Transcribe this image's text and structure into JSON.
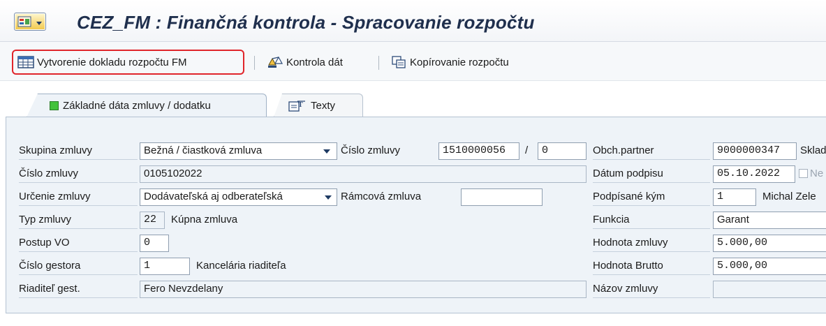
{
  "window": {
    "title": "CEZ_FM : Finančná kontrola - Spracovanie rozpočtu"
  },
  "toolbar": {
    "create_budget_doc": "Vytvorenie dokladu rozpočtu FM",
    "check_data": "Kontrola dát",
    "copy_budget": "Kopírovanie rozpočtu"
  },
  "tabs": [
    {
      "label": "Základné dáta zmluvy / dodatku",
      "active": true
    },
    {
      "label": "Texty",
      "active": false
    }
  ],
  "form": {
    "skupina_zmluvy": {
      "label": "Skupina zmluvy",
      "value": "Bežná / čiastková zmluva"
    },
    "cislo_zmluvy_ref": {
      "label": "Číslo zmluvy",
      "value1": "1510000056",
      "sep": "/",
      "value2": "0"
    },
    "cislo_zmluvy": {
      "label": "Číslo zmluvy",
      "value": "0105102022"
    },
    "urcenie_zmluvy": {
      "label": "Určenie zmluvy",
      "value": "Dodávateľská aj odberateľská"
    },
    "ramcova_zmluva": {
      "label": "Rámcová zmluva",
      "value": ""
    },
    "typ_zmluvy": {
      "label": "Typ zmluvy",
      "code": "22",
      "text": "Kúpna zmluva"
    },
    "postup_vo": {
      "label": "Postup VO",
      "value": "0"
    },
    "cislo_gestora": {
      "label": "Číslo gestora",
      "code": "1",
      "text": "Kancelária riaditeľa"
    },
    "riaditel_gest": {
      "label": "Riaditeľ gest.",
      "value": "Fero Nevzdelany"
    },
    "obch_partner": {
      "label": "Obch.partner",
      "value": "9000000347",
      "suffix": "Sklad"
    },
    "datum_podpisu": {
      "label": "Dátum podpisu",
      "value": "05.10.2022",
      "chk_label": "Ne"
    },
    "podpisane_kym": {
      "label": "Podpísané kým",
      "code": "1",
      "name": "Michal Zele"
    },
    "funkcia": {
      "label": "Funkcia",
      "value": "Garant"
    },
    "hodnota_zmluvy": {
      "label": "Hodnota zmluvy",
      "value": "5.000,00"
    },
    "hodnota_brutto": {
      "label": "Hodnota Brutto",
      "value": "5.000,00"
    },
    "nazov_zmluvy": {
      "label": "Názov zmluvy",
      "value": ""
    }
  },
  "colors": {
    "highlight_border": "#e0252b",
    "panel_bg": "#eef3f8",
    "active_tab_indicator": "#43c23b"
  }
}
